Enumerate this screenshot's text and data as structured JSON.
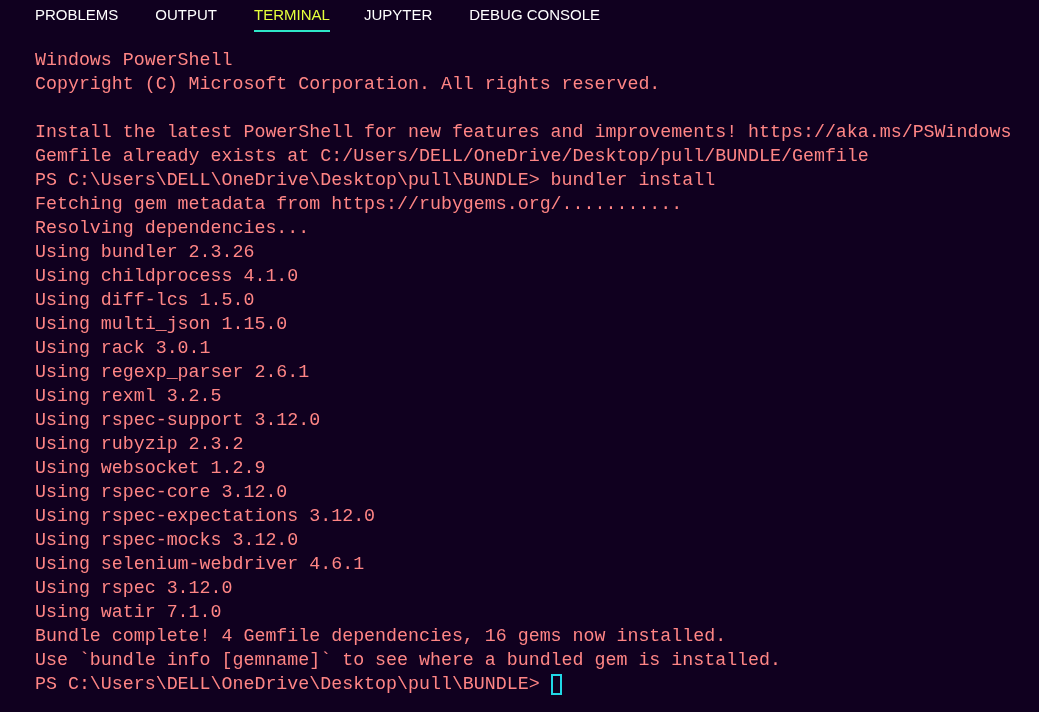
{
  "tabs": [
    {
      "label": "PROBLEMS",
      "selected": false
    },
    {
      "label": "OUTPUT",
      "selected": false
    },
    {
      "label": "TERMINAL",
      "selected": true
    },
    {
      "label": "JUPYTER",
      "selected": false
    },
    {
      "label": "DEBUG CONSOLE",
      "selected": false
    }
  ],
  "terminal": {
    "blocks": [
      {
        "lines": [
          "Windows PowerShell",
          "Copyright (C) Microsoft Corporation. All rights reserved."
        ]
      },
      {
        "lines": [
          "Install the latest PowerShell for new features and improvements! https://aka.ms/PSWindows",
          "Gemfile already exists at C:/Users/DELL/OneDrive/Desktop/pull/BUNDLE/Gemfile",
          "PS C:\\Users\\DELL\\OneDrive\\Desktop\\pull\\BUNDLE> bundler install",
          "Fetching gem metadata from https://rubygems.org/...........",
          "Resolving dependencies...",
          "Using bundler 2.3.26",
          "Using childprocess 4.1.0",
          "Using diff-lcs 1.5.0",
          "Using multi_json 1.15.0",
          "Using rack 3.0.1",
          "Using regexp_parser 2.6.1",
          "Using rexml 3.2.5",
          "Using rspec-support 3.12.0",
          "Using rubyzip 2.3.2",
          "Using websocket 1.2.9",
          "Using rspec-core 3.12.0",
          "Using rspec-expectations 3.12.0",
          "Using rspec-mocks 3.12.0",
          "Using selenium-webdriver 4.6.1",
          "Using rspec 3.12.0",
          "Using watir 7.1.0",
          "Bundle complete! 4 Gemfile dependencies, 16 gems now installed.",
          "Use `bundle info [gemname]` to see where a bundled gem is installed."
        ]
      }
    ],
    "prompt": {
      "text": "PS C:\\Users\\DELL\\OneDrive\\Desktop\\pull\\BUNDLE>",
      "cursor": true
    }
  }
}
